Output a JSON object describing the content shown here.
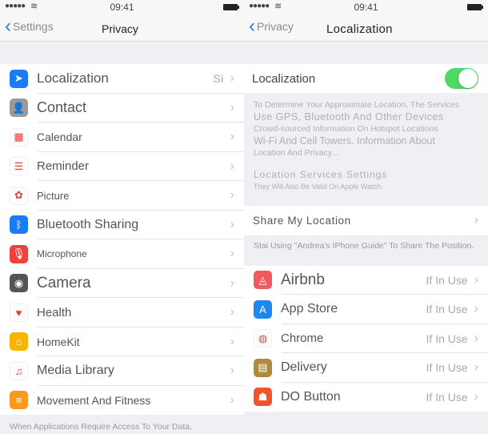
{
  "status_bar": {
    "time": "09:41",
    "signal": "●●●●●",
    "wifi": "wifi"
  },
  "left": {
    "back_label": "Settings",
    "title": "Privacy",
    "items": [
      {
        "label": "Localization",
        "value": "Sì",
        "icon": "location-arrow-icon",
        "color": "#1a7cf5",
        "glyph": "➤"
      },
      {
        "label": "Contact",
        "value": "",
        "icon": "contacts-icon",
        "color": "#9a9a9a",
        "glyph": "👤"
      },
      {
        "label": "Calendar",
        "value": "",
        "icon": "calendar-icon",
        "color": "#ffffff",
        "glyph": "▦"
      },
      {
        "label": "Reminder",
        "value": "",
        "icon": "reminders-icon",
        "color": "#ffffff",
        "glyph": "☰"
      },
      {
        "label": "Picture",
        "value": "",
        "icon": "photos-icon",
        "color": "#ffffff",
        "glyph": "✿"
      },
      {
        "label": "Bluetooth Sharing",
        "value": "",
        "icon": "bluetooth-icon",
        "color": "#1a7cf5",
        "glyph": "ᛒ"
      },
      {
        "label": "Microphone",
        "value": "",
        "icon": "microphone-icon",
        "color": "#f0413a",
        "glyph": "🎙"
      },
      {
        "label": "Camera",
        "value": "",
        "icon": "camera-icon",
        "color": "#555555",
        "glyph": "◉"
      },
      {
        "label": "Health",
        "value": "",
        "icon": "health-heart-icon",
        "color": "#ffffff",
        "glyph": "♥"
      },
      {
        "label": "HomeKit",
        "value": "",
        "icon": "homekit-icon",
        "color": "#f7b500",
        "glyph": "⌂"
      },
      {
        "label": "Media Library",
        "value": "",
        "icon": "music-note-icon",
        "color": "#ffffff",
        "glyph": "♫"
      },
      {
        "label": "Movement And Fitness",
        "value": "",
        "icon": "fitness-icon",
        "color": "#f79a1e",
        "glyph": "≡"
      }
    ],
    "footer": "When Applications Require Access To Your Data,"
  },
  "right": {
    "back_label": "Privacy",
    "title": "Localization",
    "toggle_label": "Localization",
    "toggle_on": true,
    "desc_lines": [
      "To Determine Your Approximate Location, The Services",
      "Use GPS, Bluetooth And Other Devices",
      "Crowd-sourced Information On Hotspot Locations",
      "Wi-Fi And Cell Towers. Information About",
      "Location And Privacy..."
    ],
    "settings_header": "Location Services Settings",
    "settings_sub": "They Will Also Be Valid On Apple Watch.",
    "share_label": "Share My Location",
    "share_footer": "Stai Using \"Andrea's IPhone Guide\" To Share The Position.",
    "apps": [
      {
        "label": "Airbnb",
        "value": "If In Use",
        "icon": "airbnb-icon",
        "color": "#f05a5f",
        "glyph": "◬"
      },
      {
        "label": "App Store",
        "value": "If In Use",
        "icon": "app-store-icon",
        "color": "#1e88f0",
        "glyph": "A"
      },
      {
        "label": "Chrome",
        "value": "If In Use",
        "icon": "chrome-icon",
        "color": "#ffffff",
        "glyph": "◍"
      },
      {
        "label": "Delivery",
        "value": "If In Use",
        "icon": "delivery-icon",
        "color": "#b08a3a",
        "glyph": "▤"
      },
      {
        "label": "DO Button",
        "value": "If In Use",
        "icon": "do-button-icon",
        "color": "#f0542a",
        "glyph": "☗"
      }
    ]
  },
  "colors": {
    "accent": "#1a7cf5",
    "toggle_on": "#4cd964"
  }
}
